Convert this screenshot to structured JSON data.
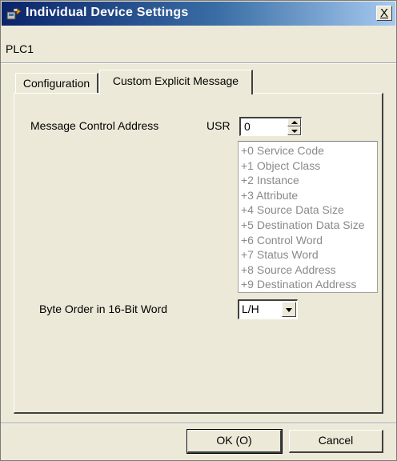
{
  "window": {
    "title": "Individual Device Settings",
    "close_label": "X"
  },
  "device": {
    "name": "PLC1"
  },
  "tabs": [
    {
      "label": "Configuration",
      "active": false
    },
    {
      "label": "Custom Explicit Message",
      "active": true
    }
  ],
  "custom_explicit_message": {
    "message_control_address_label": "Message Control Address",
    "address_prefix": "USR",
    "address_value": "0",
    "offsets": [
      "+0 Service Code",
      "+1 Object Class",
      "+2 Instance",
      "+3 Attribute",
      "+4 Source Data Size",
      "+5 Destination Data Size",
      "+6 Control Word",
      "+7 Status Word",
      "+8 Source Address",
      "+9 Destination Address"
    ],
    "byte_order_label": "Byte Order in 16-Bit Word",
    "byte_order_value": "L/H"
  },
  "buttons": {
    "ok_label": "OK (O)",
    "cancel_label": "Cancel"
  },
  "colors": {
    "dialog_background": "#ece9d8",
    "titlebar_start": "#0a246a",
    "titlebar_end": "#a6caf0",
    "disabled_text": "#8a8a8a"
  }
}
